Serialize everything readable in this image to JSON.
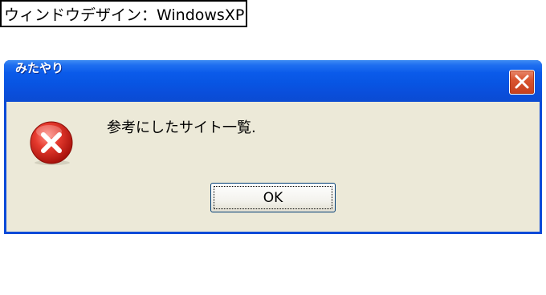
{
  "caption": "ウィンドウデザイン：WindowsXP",
  "window": {
    "title": "みたやり",
    "close_icon": "close-icon"
  },
  "dialog": {
    "icon": "error-icon",
    "message": "参考にしたサイト一覧.",
    "ok_label": "OK"
  },
  "colors": {
    "titlebar": "#0b55e3",
    "client_bg": "#ece9d8",
    "close_button": "#d9542f",
    "error_red": "#d8201c"
  }
}
